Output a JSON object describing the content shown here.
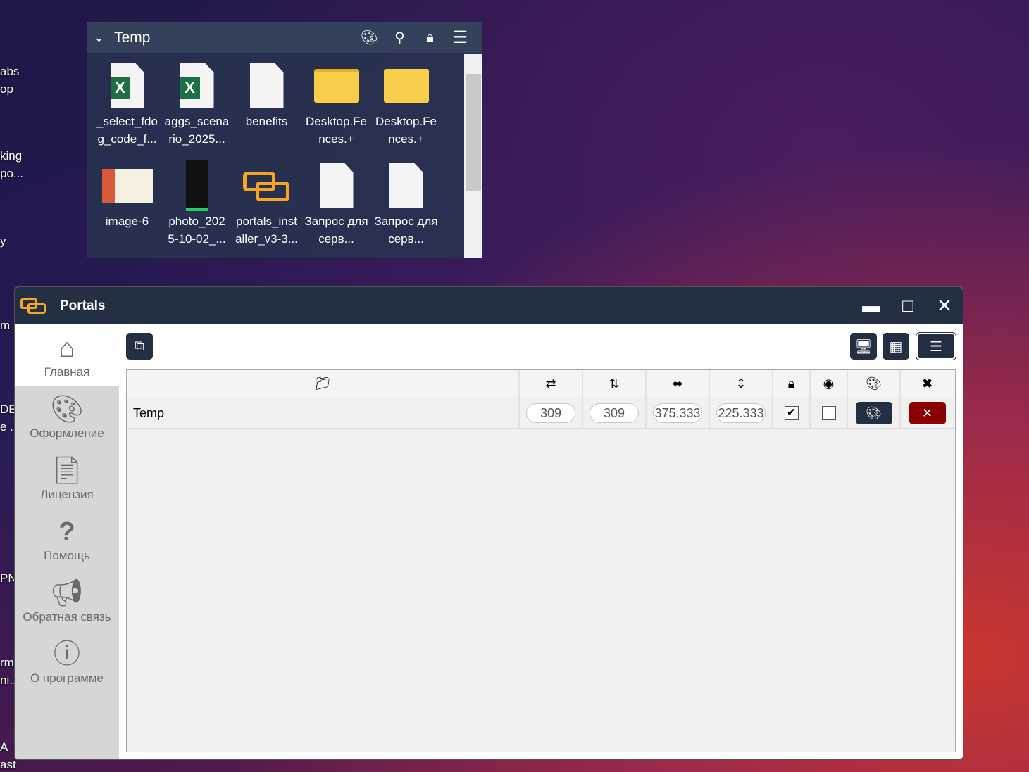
{
  "desktop": {
    "labels": [
      "abs",
      "op",
      "king",
      "po...",
      "y",
      "m",
      "DEA",
      "e ...",
      "PN",
      "rm",
      "ni..",
      "A",
      "ast"
    ]
  },
  "fence": {
    "title": "Temp",
    "icons": [
      "chevron-down",
      "palette",
      "search",
      "lock",
      "menu"
    ],
    "items": [
      {
        "name": "_select_fdo g_code_f...",
        "icon": "excel"
      },
      {
        "name": "aggs_scena rio_2025...",
        "icon": "excel"
      },
      {
        "name": "benefits",
        "icon": "document"
      },
      {
        "name": "Desktop.Fe nces.+",
        "icon": "zip-folder"
      },
      {
        "name": "Desktop.Fe nces.+",
        "icon": "folder"
      },
      {
        "name": "image-6",
        "icon": "image"
      },
      {
        "name": "photo_202 5-10-02_...",
        "icon": "photo"
      },
      {
        "name": "portals_inst aller_v3-3...",
        "icon": "portals"
      },
      {
        "name": "Запрос для серв...",
        "icon": "document"
      },
      {
        "name": "Запрос для серв...",
        "icon": "document"
      }
    ]
  },
  "window": {
    "title": "Portals",
    "controls": [
      "minimize",
      "maximize",
      "close"
    ]
  },
  "sidebar": {
    "items": [
      {
        "label": "Главная",
        "icon": "home",
        "active": true
      },
      {
        "label": "Оформление",
        "icon": "palette"
      },
      {
        "label": "Лицензия",
        "icon": "file"
      },
      {
        "label": "Помощь",
        "icon": "question"
      },
      {
        "label": "Обратная связь",
        "icon": "megaphone"
      },
      {
        "label": "О программе",
        "icon": "info"
      }
    ]
  },
  "table": {
    "headers": [
      "folder",
      "swap-horizontal",
      "swap-vertical",
      "width",
      "height",
      "lock",
      "eye",
      "palette",
      "close"
    ],
    "rows": [
      {
        "name": "Temp",
        "x": "309",
        "y": "309",
        "width": "375.333",
        "height": "225.333",
        "locked": true,
        "visible": false
      }
    ]
  },
  "colors": {
    "accent": "#233044",
    "danger": "#8b0000",
    "brand": "#f5a623"
  }
}
